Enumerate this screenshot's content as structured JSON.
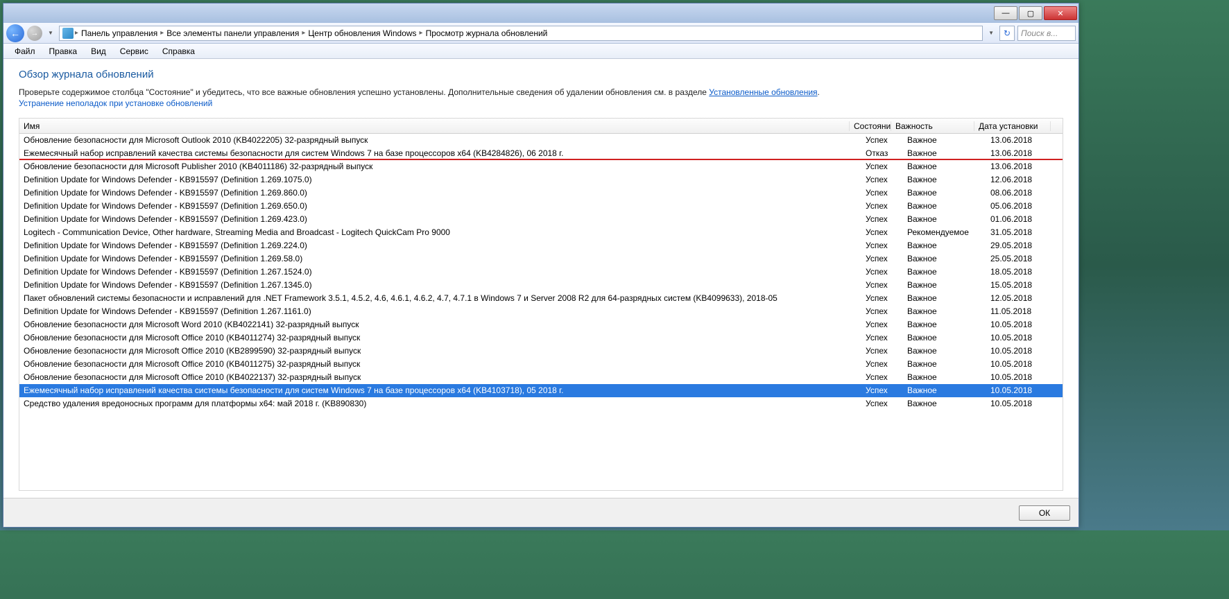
{
  "titlebar": {
    "min": "—",
    "max": "▢",
    "close": "✕"
  },
  "nav": {
    "crumbs": [
      "Панель управления",
      "Все элементы панели управления",
      "Центр обновления Windows",
      "Просмотр журнала обновлений"
    ],
    "refresh": "↻",
    "search_placeholder": "Поиск в..."
  },
  "menu": [
    "Файл",
    "Правка",
    "Вид",
    "Сервис",
    "Справка"
  ],
  "page": {
    "title": "Обзор журнала обновлений",
    "desc_pre": "Проверьте содержимое столбца \"Состояние\" и убедитесь, что все важные обновления успешно установлены. Дополнительные сведения об удалении обновления см. в разделе ",
    "desc_link": "Установленные обновления",
    "desc_post": ".",
    "link2": "Устранение неполадок при установке обновлений"
  },
  "columns": {
    "name": "Имя",
    "state": "Состояние",
    "importance": "Важность",
    "date": "Дата установки"
  },
  "rows": [
    {
      "name": "Обновление безопасности для Microsoft Outlook 2010 (KB4022205) 32-разрядный выпуск",
      "state": "Успех",
      "importance": "Важное",
      "date": "13.06.2018"
    },
    {
      "name": "Ежемесячный набор исправлений качества системы безопасности для систем Windows 7 на базе процессоров x64 (KB4284826), 06 2018 г.",
      "state": "Отказ",
      "importance": "Важное",
      "date": "13.06.2018",
      "highlighted": true
    },
    {
      "name": "Обновление безопасности для Microsoft Publisher 2010 (KB4011186) 32-разрядный выпуск",
      "state": "Успех",
      "importance": "Важное",
      "date": "13.06.2018"
    },
    {
      "name": "Definition Update for Windows Defender - KB915597 (Definition 1.269.1075.0)",
      "state": "Успех",
      "importance": "Важное",
      "date": "12.06.2018"
    },
    {
      "name": "Definition Update for Windows Defender - KB915597 (Definition 1.269.860.0)",
      "state": "Успех",
      "importance": "Важное",
      "date": "08.06.2018"
    },
    {
      "name": "Definition Update for Windows Defender - KB915597 (Definition 1.269.650.0)",
      "state": "Успех",
      "importance": "Важное",
      "date": "05.06.2018"
    },
    {
      "name": "Definition Update for Windows Defender - KB915597 (Definition 1.269.423.0)",
      "state": "Успех",
      "importance": "Важное",
      "date": "01.06.2018"
    },
    {
      "name": "Logitech - Communication Device, Other hardware, Streaming Media and Broadcast - Logitech QuickCam Pro 9000",
      "state": "Успех",
      "importance": "Рекомендуемое",
      "date": "31.05.2018"
    },
    {
      "name": "Definition Update for Windows Defender - KB915597 (Definition 1.269.224.0)",
      "state": "Успех",
      "importance": "Важное",
      "date": "29.05.2018"
    },
    {
      "name": "Definition Update for Windows Defender - KB915597 (Definition 1.269.58.0)",
      "state": "Успех",
      "importance": "Важное",
      "date": "25.05.2018"
    },
    {
      "name": "Definition Update for Windows Defender - KB915597 (Definition 1.267.1524.0)",
      "state": "Успех",
      "importance": "Важное",
      "date": "18.05.2018"
    },
    {
      "name": "Definition Update for Windows Defender - KB915597 (Definition 1.267.1345.0)",
      "state": "Успех",
      "importance": "Важное",
      "date": "15.05.2018"
    },
    {
      "name": "Пакет обновлений системы безопасности и исправлений для .NET Framework 3.5.1, 4.5.2, 4.6, 4.6.1, 4.6.2, 4.7, 4.7.1 в Windows 7 и Server 2008 R2 для 64-разрядных систем (KB4099633), 2018-05",
      "state": "Успех",
      "importance": "Важное",
      "date": "12.05.2018"
    },
    {
      "name": "Definition Update for Windows Defender - KB915597 (Definition 1.267.1161.0)",
      "state": "Успех",
      "importance": "Важное",
      "date": "11.05.2018"
    },
    {
      "name": "Обновление безопасности для Microsoft Word 2010 (KB4022141) 32-разрядный выпуск",
      "state": "Успех",
      "importance": "Важное",
      "date": "10.05.2018"
    },
    {
      "name": "Обновление безопасности для Microsoft Office 2010 (KB4011274) 32-разрядный выпуск",
      "state": "Успех",
      "importance": "Важное",
      "date": "10.05.2018"
    },
    {
      "name": "Обновление безопасности для Microsoft Office 2010 (KB2899590) 32-разрядный выпуск",
      "state": "Успех",
      "importance": "Важное",
      "date": "10.05.2018"
    },
    {
      "name": "Обновление безопасности для Microsoft Office 2010 (KB4011275) 32-разрядный выпуск",
      "state": "Успех",
      "importance": "Важное",
      "date": "10.05.2018"
    },
    {
      "name": "Обновление безопасности для Microsoft Office 2010 (KB4022137) 32-разрядный выпуск",
      "state": "Успех",
      "importance": "Важное",
      "date": "10.05.2018"
    },
    {
      "name": "Ежемесячный набор исправлений качества системы безопасности для систем Windows 7 на базе процессоров x64 (KB4103718), 05 2018 г.",
      "state": "Успех",
      "importance": "Важное",
      "date": "10.05.2018",
      "selected": true
    },
    {
      "name": "Средство удаления вредоносных программ для платформы x64: май 2018 г. (KB890830)",
      "state": "Успех",
      "importance": "Важное",
      "date": "10.05.2018"
    }
  ],
  "footer": {
    "ok": "ОК"
  }
}
